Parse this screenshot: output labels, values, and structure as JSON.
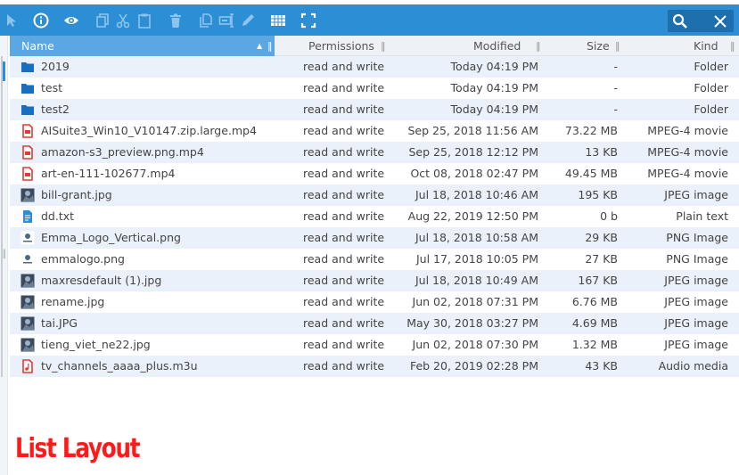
{
  "colors": {
    "toolbar": "#2c8fd6",
    "header_active": "#5aa7e3",
    "row_alt": "#eaf1fa",
    "folder": "#1a6ec0",
    "overlay": "#ff1a1a"
  },
  "toolbar": {
    "icons": [
      "select-icon",
      "info-icon",
      "preview-icon",
      "copy-icon",
      "cut-icon",
      "paste-icon",
      "delete-icon",
      "duplicate-icon",
      "rename-icon",
      "edit-icon",
      "view-grid-icon",
      "fullscreen-icon"
    ],
    "search": {
      "placeholder": ""
    }
  },
  "columns": {
    "name": "Name",
    "permissions": "Permissions",
    "modified": "Modified",
    "size": "Size",
    "kind": "Kind"
  },
  "files": [
    {
      "icon": "folder-icon",
      "name": "2019",
      "permissions": "read and write",
      "modified": "Today 04:19 PM",
      "size": "-",
      "kind": "Folder"
    },
    {
      "icon": "folder-icon",
      "name": "test",
      "permissions": "read and write",
      "modified": "Today 04:19 PM",
      "size": "-",
      "kind": "Folder"
    },
    {
      "icon": "folder-icon",
      "name": "test2",
      "permissions": "read and write",
      "modified": "Today 04:19 PM",
      "size": "-",
      "kind": "Folder"
    },
    {
      "icon": "video-file-icon",
      "name": "AISuite3_Win10_V10147.zip.large.mp4",
      "permissions": "read and write",
      "modified": "Sep 25, 2018 11:56 AM",
      "size": "73.22 MB",
      "kind": "MPEG-4 movie"
    },
    {
      "icon": "video-file-icon",
      "name": "amazon-s3_preview.png.mp4",
      "permissions": "read and write",
      "modified": "Sep 25, 2018 12:12 PM",
      "size": "13 KB",
      "kind": "MPEG-4 movie"
    },
    {
      "icon": "video-file-icon",
      "name": "art-en-111-102677.mp4",
      "permissions": "read and write",
      "modified": "Oct 08, 2018 02:47 PM",
      "size": "49.45 MB",
      "kind": "MPEG-4 movie"
    },
    {
      "icon": "image-thumbnail-icon",
      "name": "bill-grant.jpg",
      "permissions": "read and write",
      "modified": "Jul 18, 2018 10:46 AM",
      "size": "195 KB",
      "kind": "JPEG image"
    },
    {
      "icon": "text-file-icon",
      "name": "dd.txt",
      "permissions": "read and write",
      "modified": "Aug 22, 2019 12:50 PM",
      "size": "0 b",
      "kind": "Plain text"
    },
    {
      "icon": "logo-thumbnail-icon",
      "name": "Emma_Logo_Vertical.png",
      "permissions": "read and write",
      "modified": "Jul 18, 2018 10:58 AM",
      "size": "29 KB",
      "kind": "PNG Image"
    },
    {
      "icon": "logo-thumbnail-icon",
      "name": "emmalogo.png",
      "permissions": "read and write",
      "modified": "Jul 17, 2018 10:05 PM",
      "size": "27 KB",
      "kind": "PNG Image"
    },
    {
      "icon": "image-thumbnail-icon",
      "name": "maxresdefault (1).jpg",
      "permissions": "read and write",
      "modified": "Jul 18, 2018 10:49 AM",
      "size": "167 KB",
      "kind": "JPEG image"
    },
    {
      "icon": "image-thumbnail-icon",
      "name": "rename.jpg",
      "permissions": "read and write",
      "modified": "Jun 02, 2018 07:31 PM",
      "size": "6.76 MB",
      "kind": "JPEG image"
    },
    {
      "icon": "image-thumbnail-icon",
      "name": "tai.JPG",
      "permissions": "read and write",
      "modified": "May 30, 2018 03:27 PM",
      "size": "4.69 MB",
      "kind": "JPEG image"
    },
    {
      "icon": "image-thumbnail-icon",
      "name": "tieng_viet_ne22.jpg",
      "permissions": "read and write",
      "modified": "Jun 02, 2018 07:30 PM",
      "size": "1.32 MB",
      "kind": "JPEG image"
    },
    {
      "icon": "audio-file-icon",
      "name": "tv_channels_aaaa_plus.m3u",
      "permissions": "read and write",
      "modified": "Feb 20, 2019 02:28 PM",
      "size": "43 KB",
      "kind": "Audio media"
    }
  ],
  "overlay_label": "List Layout"
}
